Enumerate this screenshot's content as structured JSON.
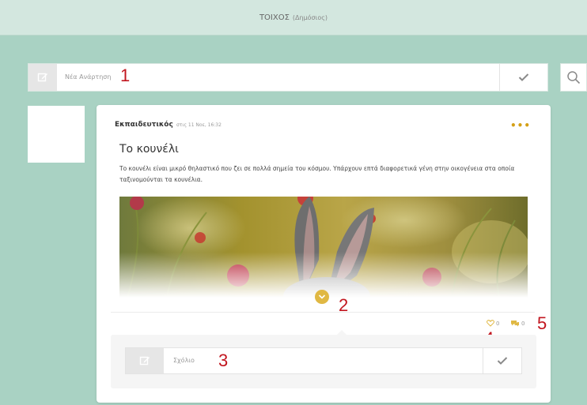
{
  "header": {
    "title": "ΤΟΙΧΟΣ",
    "subtitle": "(Δημόσιος)"
  },
  "new_post": {
    "placeholder": "Νέα Ανάρτηση"
  },
  "post": {
    "author": "Εκπαιδευτικός",
    "time": "στις 11 Νοε, 16:32",
    "more": "•••",
    "title": "Το κουνέλι",
    "body": "Το κουνέλι είναι μικρό θηλαστικό που ζει σε πολλά σημεία του κόσμου. Υπάρχουν επτά διαφορετικά γένη στην οικογένεια στα οποία ταξινομούνται τα κουνέλια.",
    "likes": "0",
    "comments": "0"
  },
  "comment": {
    "placeholder": "Σχόλιο"
  },
  "callouts": [
    "1",
    "2",
    "3",
    "4",
    "5"
  ],
  "icons": {
    "edit": "edit-icon",
    "check": "check-icon",
    "search": "search-icon",
    "expand": "chevron-down-icon",
    "heart": "heart-icon",
    "comment": "comment-icon"
  },
  "colors": {
    "background": "#a9d2c3",
    "accent": "#e0b843",
    "callout": "#c2161f"
  }
}
